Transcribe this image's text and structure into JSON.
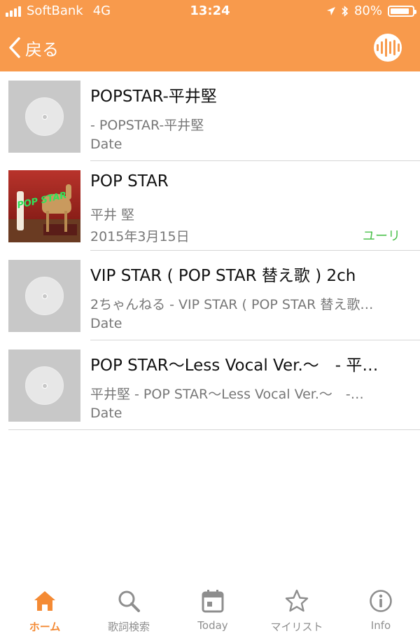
{
  "status_bar": {
    "carrier": "SoftBank",
    "network": "4G",
    "time": "13:24",
    "battery": "80%"
  },
  "nav": {
    "back_label": "戻る"
  },
  "results": [
    {
      "title": "POPSTAR-平井堅",
      "subtitle": " - POPSTAR-平井堅",
      "meta": "Date",
      "tag": "",
      "artwork": "placeholder-disc"
    },
    {
      "title": "POP STAR",
      "subtitle": "平井 堅",
      "meta": "2015年3月15日",
      "tag": "ユーリ",
      "artwork": "album-cover"
    },
    {
      "title": "VIP STAR ( POP STAR 替え歌 ) 2ch",
      "subtitle": "2ちゃんねる - VIP STAR ( POP STAR 替え歌…",
      "meta": "Date",
      "tag": "",
      "artwork": "placeholder-disc"
    },
    {
      "title": "POP STAR～Less Vocal Ver.～　- 平…",
      "subtitle": "平井堅 - POP STAR～Less Vocal Ver.～　-…",
      "meta": "Date",
      "tag": "",
      "artwork": "placeholder-disc"
    }
  ],
  "album_art": {
    "logo_text": "POP STAR"
  },
  "tabs": [
    {
      "label": "ホーム",
      "icon": "home-icon",
      "active": true
    },
    {
      "label": "歌詞検索",
      "icon": "search-icon",
      "active": false
    },
    {
      "label": "Today",
      "icon": "calendar-icon",
      "active": false
    },
    {
      "label": "マイリスト",
      "icon": "star-icon",
      "active": false
    },
    {
      "label": "Info",
      "icon": "info-icon",
      "active": false
    }
  ],
  "colors": {
    "accent": "#f89a4c",
    "tab_active": "#f48a34",
    "tag": "#4cc14c"
  }
}
